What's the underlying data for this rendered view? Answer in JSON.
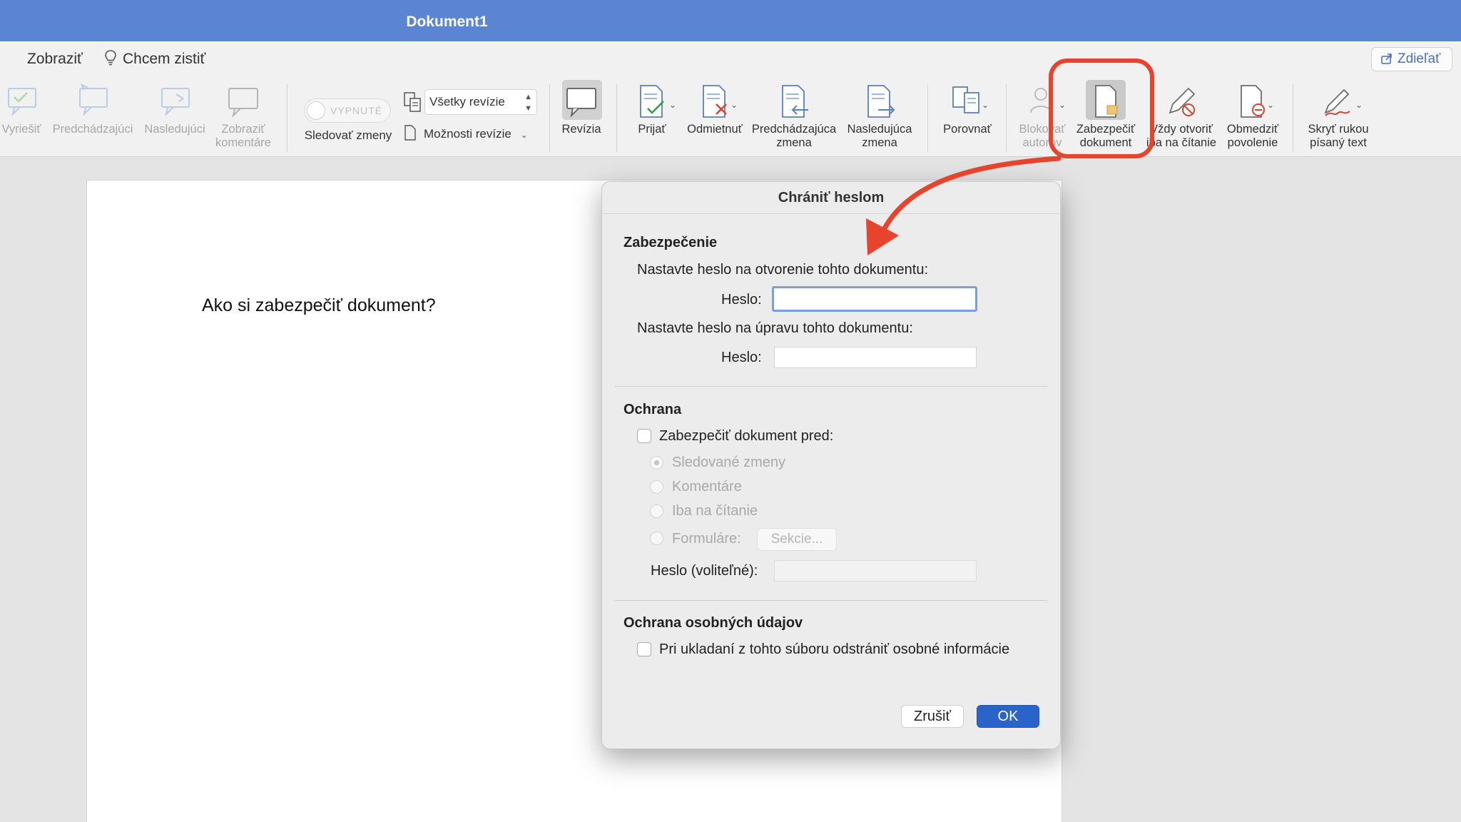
{
  "window": {
    "title": "Dokument1"
  },
  "menu": {
    "items": [
      {
        "label": "Zobraziť"
      },
      {
        "label": "Chcem zistiť"
      }
    ],
    "share_label": "Zdieľať"
  },
  "ribbon": {
    "resolve": "Vyriešiť",
    "previous": "Predchádzajúci",
    "next": "Nasledujúci",
    "show_comments": "Zobraziť\nkomentáre",
    "track_toggle_state": "VYPNUTÉ",
    "track_changes": "Sledovať zmeny",
    "markup_select": "Všetky revízie",
    "markup_options": "Možnosti revízie",
    "reviewing_pane": "Revízia",
    "accept": "Prijať",
    "reject": "Odmietnuť",
    "previous_change": "Predchádzajúca\nzmena",
    "next_change": "Nasledujúca\nzmena",
    "compare": "Porovnať",
    "block_authors": "Blokovať\nautorov",
    "protect_document": "Zabezpečiť\ndokument",
    "always_open_readonly": "Vždy otvoriť\niba na čítanie",
    "restrict_permission": "Obmedziť\npovolenie",
    "hide_ink": "Skryť rukou\npísaný text"
  },
  "document": {
    "heading": "Ako si zabezpečiť dokument?"
  },
  "dialog": {
    "title": "Chrániť heslom",
    "security_heading": "Zabezpečenie",
    "open_password_label": "Nastavte heslo na otvorenie tohto dokumentu:",
    "password_label": "Heslo:",
    "modify_password_label": "Nastavte heslo na úpravu tohto dokumentu:",
    "password_label_2": "Heslo:",
    "protection_heading": "Ochrana",
    "protect_checkbox": "Zabezpečiť dokument pred:",
    "radio_tracked": "Sledované zmeny",
    "radio_comments": "Komentáre",
    "radio_readonly": "Iba na čítanie",
    "radio_forms": "Formuláre:",
    "sections_button": "Sekcie...",
    "optional_password_label": "Heslo (voliteľné):",
    "privacy_heading": "Ochrana osobných údajov",
    "privacy_checkbox": "Pri ukladaní z tohto súboru odstrániť osobné informácie",
    "cancel": "Zrušiť",
    "ok": "OK"
  },
  "colors": {
    "titlebar": "#5b84d3",
    "accent": "#2a63c9",
    "annotation": "#e8432c"
  }
}
